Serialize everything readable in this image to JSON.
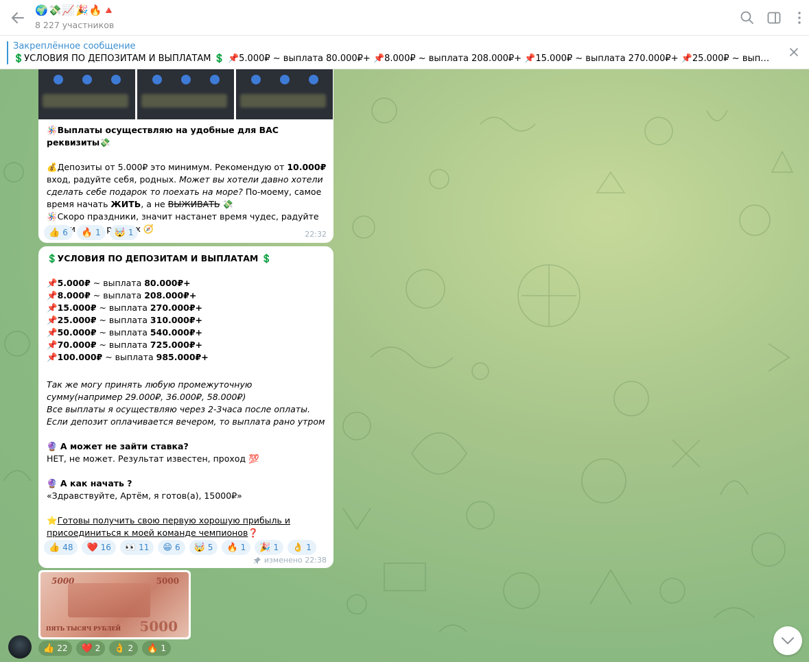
{
  "header": {
    "title": "🌍💸📈🎉🔥🔺",
    "subtitle": "8 227 участников"
  },
  "pinned": {
    "label": "Закреплённое сообщение",
    "text": "💲УСЛОВИЯ ПО ДЕПОЗИТАМ И ВЫПЛАТАМ 💲 📌5.000₽ ~ выплата 80.000₽+ 📌8.000₽ ~ выплата 208.000₽+ 📌15.000₽ ~ выплата 270.000₽+ 📌25.000₽ ~ выплата 310.000₽+ ..."
  },
  "screenshots": [
    {
      "label1": "Документы по операции",
      "label2": "Добавить в избранное",
      "label3": "Регулярный платеж"
    },
    {
      "label1": "Документы по операции",
      "label2": "Добавить в избранное",
      "label3": "Регулярный платеж"
    },
    {
      "label1": "Документы по операции",
      "label2": "Добавить в избранное",
      "label3": "Регулярный платеж"
    }
  ],
  "msg1": {
    "line1_icon": "🪅",
    "line1": "Выплаты осуществляю на удобные для ВАС реквизиты",
    "line1_end": "💸",
    "p2_icon": "💰",
    "p2_a": "Депозиты от 5.000₽ это минимум. Рекомендую от ",
    "p2_b": "10.000₽",
    "p2_c": " вход, радуйте  себя, родных. ",
    "p2_italic": "Может вы хотели давно хотели сделать себе подарок то поехать на море?",
    "p2_d": " По-моему, самое время начать ",
    "p2_e": "ЖИТЬ",
    "p2_f": ", а не ",
    "p2_strike": "ВЫЖИВАТЬ",
    "p2_end": " 💸",
    "p3_icon": "🪅",
    "p3": "Скоро праздники, значит настанет время чудес, радуйте себя и своих родных ",
    "p3_end": "🧭",
    "reactions": [
      {
        "emoji": "👍",
        "count": "6"
      },
      {
        "emoji": "🔥",
        "count": "1"
      },
      {
        "emoji": "🤯",
        "count": "1"
      }
    ],
    "time": "22:32"
  },
  "msg2": {
    "heading_icon": "💲",
    "heading": "УСЛОВИЯ ПО ДЕПОЗИТАМ И ВЫПЛАТАМ ",
    "heading_end": "💲",
    "rows": [
      {
        "dep": "5.000₽",
        "sep": " ~ выплата ",
        "pay": "80.000₽+"
      },
      {
        "dep": "8.000₽",
        "sep": " ~ выплата ",
        "pay": "208.000₽+"
      },
      {
        "dep": "15.000₽",
        "sep": " ~ выплата ",
        "pay": "270.000₽+"
      },
      {
        "dep": "25.000₽",
        "sep": " ~ выплата ",
        "pay": "310.000₽+"
      },
      {
        "dep": "50.000₽",
        "sep": " ~ выплата ",
        "pay": "540.000₽+"
      },
      {
        "dep": "70.000₽",
        "sep": " ~ выплата ",
        "pay": "725.000₽+"
      },
      {
        "dep": "100.000₽",
        "sep": " ~ выплата ",
        "pay": "985.000₽+"
      }
    ],
    "italic1": "Так же могу принять любую промежуточную сумму(например 29.000₽, 36.000₽, 58.000₽)",
    "italic2": "Все выплаты я осуществляю через 2-3часа после оплаты. Если депозит оплачивается вечером, то выплата рано утром",
    "q1_icon": "🔮",
    "q1": " А может не зайти ставка?",
    "a1": "НЕТ, не может. Результат известен, проход ",
    "a1_end": "💯",
    "q2_icon": "🔮",
    "q2": " А как начать ?",
    "a2": "«Здравствуйте, Артём, я готов(а), 15000₽»",
    "cta_icon": "⭐",
    "cta": "Готовы получить свою первую хорошую прибыль и присоединиться к моей команде чемпионов",
    "cta_end": "❓",
    "reactions": [
      {
        "emoji": "👍",
        "count": "48"
      },
      {
        "emoji": "❤️",
        "count": "16"
      },
      {
        "emoji": "👀",
        "count": "11"
      },
      {
        "emoji": "😁",
        "count": "6"
      },
      {
        "emoji": "🤯",
        "count": "5"
      },
      {
        "emoji": "🔥",
        "count": "1"
      },
      {
        "emoji": "🎉",
        "count": "1"
      },
      {
        "emoji": "👌",
        "count": "1"
      }
    ],
    "edited": "изменено 22:38"
  },
  "msg3": {
    "note_value": "5000",
    "note_text": "ПЯТЬ ТЫСЯЧ РУБЛЕЙ",
    "reactions": [
      {
        "emoji": "👍",
        "count": "22"
      },
      {
        "emoji": "❤️",
        "count": "2"
      },
      {
        "emoji": "👌",
        "count": "2"
      },
      {
        "emoji": "🔥",
        "count": "1"
      }
    ]
  },
  "colors": {
    "accent": "#3a95d5",
    "reaction_bg": "#e8f2fb",
    "chat_bg": "#a7c58b"
  },
  "icons": [
    "back-arrow-icon",
    "search-icon",
    "sidebar-toggle-icon",
    "more-vertical-icon",
    "close-icon",
    "chevron-down-icon",
    "pin-icon"
  ]
}
